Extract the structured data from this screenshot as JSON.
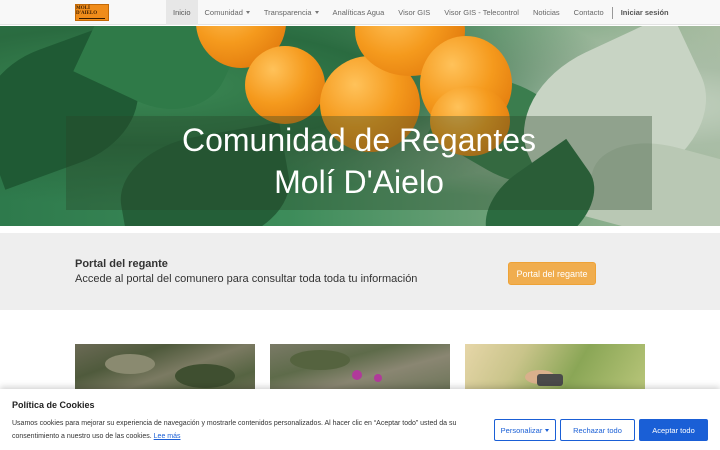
{
  "logo": {
    "text": "MOLÍ D'AIELO"
  },
  "nav": {
    "items": [
      {
        "label": "Inicio"
      },
      {
        "label": "Comunidad"
      },
      {
        "label": "Transparencia"
      },
      {
        "label": "Analíticas Agua"
      },
      {
        "label": "Visor GIS"
      },
      {
        "label": "Visor GIS - Telecontrol"
      },
      {
        "label": "Noticias"
      },
      {
        "label": "Contacto"
      }
    ],
    "login": "Iniciar sesión"
  },
  "hero": {
    "title_line1": "Comunidad de Regantes",
    "title_line2": "Molí D'Aielo"
  },
  "portal": {
    "title": "Portal del regante",
    "subtitle": "Accede al portal del comunero para consultar toda toda tu información",
    "button": "Portal del regante"
  },
  "cookie": {
    "title": "Política de Cookies",
    "text": "Usamos cookies para mejorar su experiencia de navegación y mostrarle contenidos personalizados. Al hacer clic en “Aceptar todo” usted da su consentimiento a nuestro uso de las cookies.",
    "link": "Lee más",
    "personalize": "Personalizar",
    "reject": "Rechazar todo",
    "accept": "Aceptar todo"
  },
  "colors": {
    "accent_orange": "#f0ad4e",
    "primary_blue": "#1a5fd6"
  }
}
